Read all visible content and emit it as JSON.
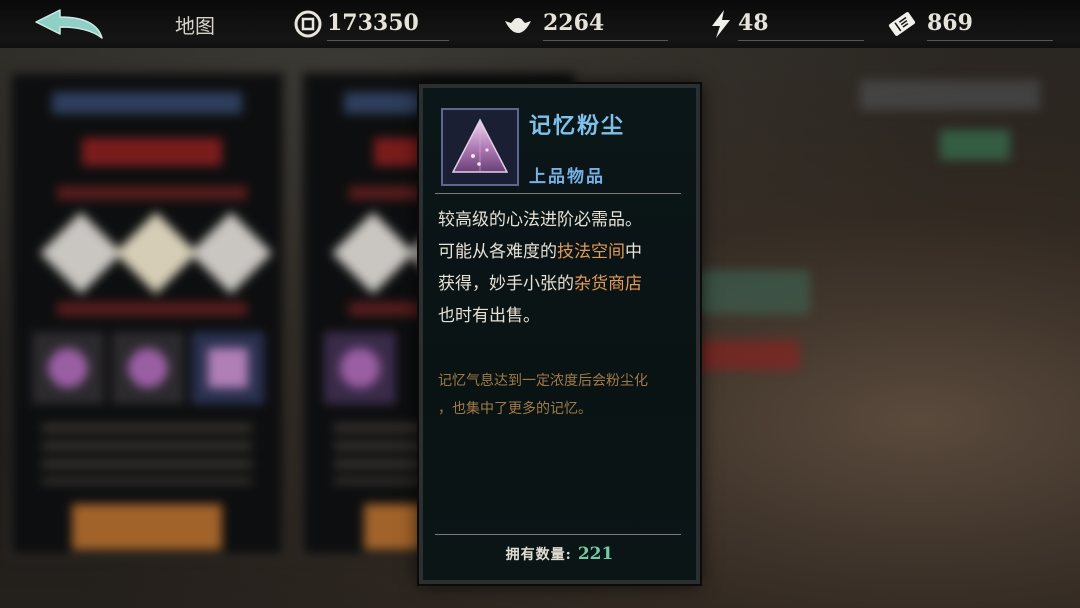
{
  "topbar": {
    "map_label": "地图",
    "resources": [
      {
        "icon": "coin-icon",
        "value": "173350"
      },
      {
        "icon": "silver-ingot-icon",
        "value": "2264"
      },
      {
        "icon": "lightning-icon",
        "value": "48"
      },
      {
        "icon": "ticket-icon",
        "value": "869"
      }
    ]
  },
  "tooltip": {
    "item_icon": "memory-dust-icon",
    "name": "记忆粉尘",
    "grade": "上品物品",
    "description": {
      "line1": "较高级的心法进阶必需品。",
      "line2_pre": "可能从各难度的",
      "line2_hl": "技法空间",
      "line2_post": "中",
      "line3_pre": "获得，妙手小张的",
      "line3_hl": "杂货商店",
      "line4": "也时有出售。"
    },
    "flavor_line1": "记忆气息达到一定浓度后会粉尘化",
    "flavor_line2": "，也集中了更多的记忆。",
    "count_label": "拥有数量:",
    "count_value": "221"
  },
  "colors": {
    "name": "#7fc3ec",
    "grade": "#76b2e6",
    "highlight": "#e19a57",
    "flavor": "#a07a47",
    "count": "#74c9a6"
  }
}
